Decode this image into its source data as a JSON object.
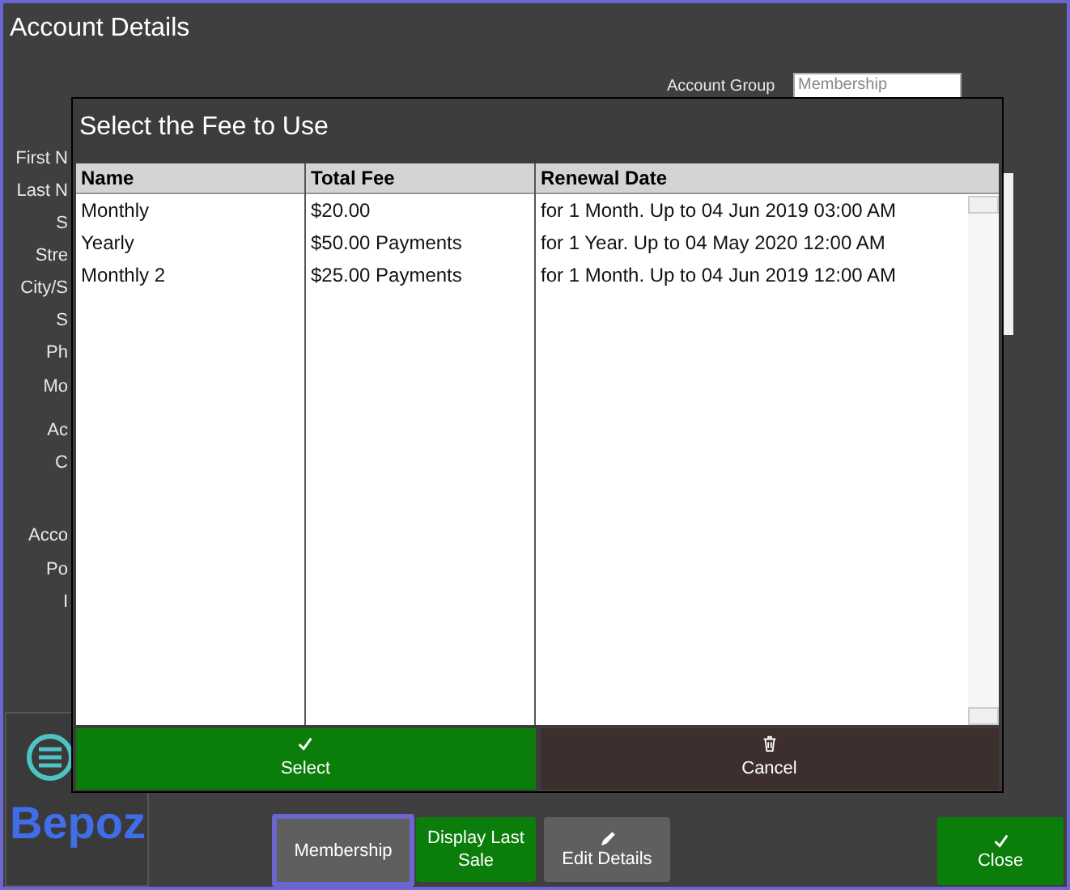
{
  "window": {
    "title": "Account Details"
  },
  "form_labels": [
    "First N",
    "Last N",
    "S",
    "Stre",
    "City/S",
    "S",
    "Ph",
    "Mo",
    "Ac",
    "C",
    "Acco",
    "Po",
    "I"
  ],
  "account_group": {
    "label": "Account Group",
    "value": "Membership"
  },
  "dialog": {
    "title": "Select the Fee to Use",
    "columns": [
      "Name",
      "Total Fee",
      "Renewal Date"
    ],
    "rows": [
      [
        "Monthly",
        "$20.00",
        "for 1 Month. Up to 04 Jun 2019 03:00 AM"
      ],
      [
        "Yearly",
        "$50.00 Payments",
        "for 1 Year. Up to 04 May 2020 12:00 AM"
      ],
      [
        "Monthly 2",
        "$25.00 Payments",
        "for 1 Month. Up to 04 Jun 2019 12:00 AM"
      ]
    ],
    "buttons": [
      {
        "label": "Select",
        "kind": "confirm"
      },
      {
        "label": "Cancel",
        "kind": "cancel"
      }
    ]
  },
  "logo": {
    "text": "Bepoz"
  },
  "buttons": [
    {
      "label": "Membership",
      "kind": "neutral",
      "focused": true
    },
    {
      "label": "Display Last Sale",
      "kind": "action",
      "focused": false
    },
    {
      "label": "Edit Details",
      "kind": "edit",
      "focused": false
    },
    {
      "label": "Close",
      "kind": "close",
      "focused": false
    }
  ]
}
